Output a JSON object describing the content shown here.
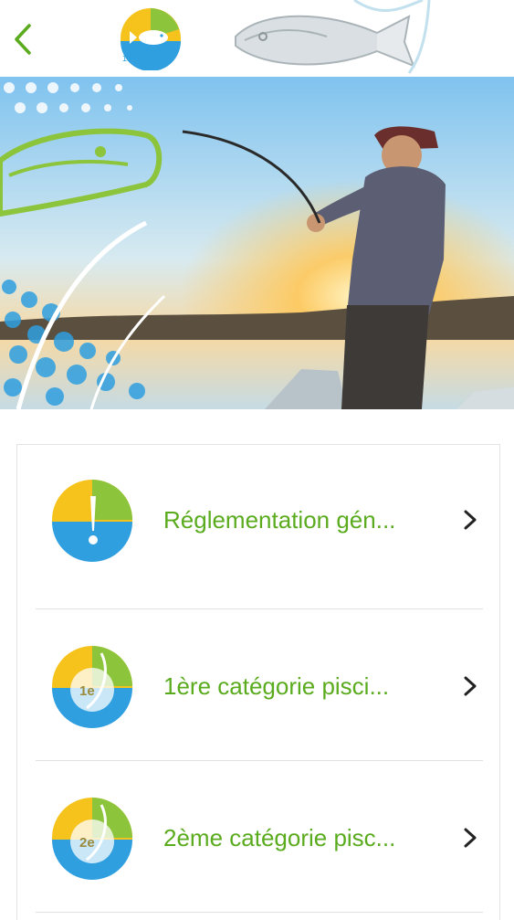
{
  "header": {
    "back_icon": "chevron-left-icon",
    "logo_number": "13"
  },
  "menu": {
    "items": [
      {
        "label": "Réglementation gén...",
        "icon": "exclamation-badge-icon",
        "badge": ""
      },
      {
        "label": "1ère catégorie pisci...",
        "icon": "first-category-badge-icon",
        "badge": "1e"
      },
      {
        "label": "2ème catégorie pisc...",
        "icon": "second-category-badge-icon",
        "badge": "2e"
      }
    ]
  },
  "colors": {
    "accent_green": "#5aab1e",
    "brand_yellow": "#f6c21c",
    "brand_blue": "#2f9fe0",
    "brand_lime": "#8cc43c"
  }
}
